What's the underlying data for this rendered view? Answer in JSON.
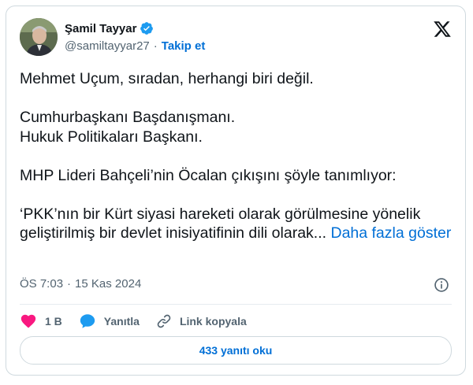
{
  "author": {
    "name": "Şamil Tayyar",
    "handle": "@samiltayyar27",
    "separator": "·",
    "follow_label": "Takip et",
    "verified": true
  },
  "tweet": {
    "lines": [
      "Mehmet Uçum, sıradan, herhangi biri değil.",
      "",
      "Cumhurbaşkanı Başdanışmanı.",
      "Hukuk Politikaları Başkanı.",
      "",
      "MHP Lideri Bahçeli’nin Öcalan çıkışını şöyle tanımlıyor:",
      "",
      "‘PKK’nın bir Kürt siyasi hareketi olarak görülmesine yönelik",
      "geliştirilmiş bir devlet inisiyatifinin dili olarak..."
    ],
    "more_label": "Daha fazla göster"
  },
  "meta": {
    "time": "ÖS 7:03",
    "separator": "·",
    "date": "15 Kas 2024"
  },
  "actions": {
    "likes": "1 B",
    "reply_label": "Yanıtla",
    "copy_link_label": "Link kopyala"
  },
  "replies_button": "433 yanıtı oku",
  "colors": {
    "accent": "#006fd6",
    "like": "#f91880",
    "reply": "#1d9bf0",
    "verified": "#1d9bf0",
    "muted": "#536471",
    "border": "#cfd9de"
  },
  "icons": {
    "verified": "verified-badge-icon",
    "brand": "x-logo-icon",
    "info": "info-icon",
    "like": "heart-icon",
    "reply": "speech-bubble-icon",
    "copy": "link-icon"
  }
}
